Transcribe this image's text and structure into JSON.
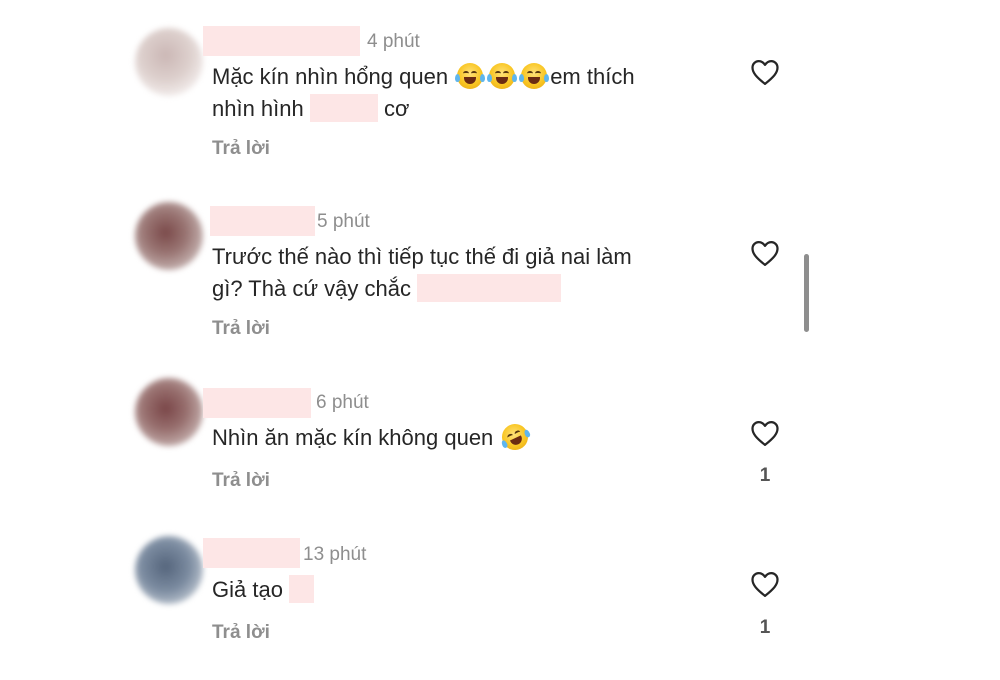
{
  "comments": [
    {
      "time": "4 phút",
      "text_line1_a": "Mặc kín nhìn hổng quen",
      "text_line1_b": "em thích",
      "text_line2_a": "nhìn hình",
      "text_line2_b": "cơ",
      "emojis": [
        "face-with-tears-of-joy-icon",
        "face-with-tears-of-joy-icon",
        "face-with-tears-of-joy-icon"
      ],
      "reply": "Trả lời",
      "likes": ""
    },
    {
      "time": "5 phút",
      "text_line1": "Trước thế nào thì tiếp tục thế đi giả nai làm",
      "text_line2": "gì? Thà cứ vậy chắc",
      "reply": "Trả lời",
      "likes": ""
    },
    {
      "time": "6 phút",
      "text_line1": "Nhìn ăn mặc kín không quen",
      "emojis": [
        "rolling-on-floor-laughing-icon"
      ],
      "reply": "Trả lời",
      "likes": "1"
    },
    {
      "time": "13 phút",
      "text_line1": "Giả tạo",
      "reply": "Trả lời",
      "likes": "1"
    }
  ],
  "colors": {
    "text": "#262626",
    "muted": "#8e8e8e",
    "redaction": "#fde6e6"
  }
}
